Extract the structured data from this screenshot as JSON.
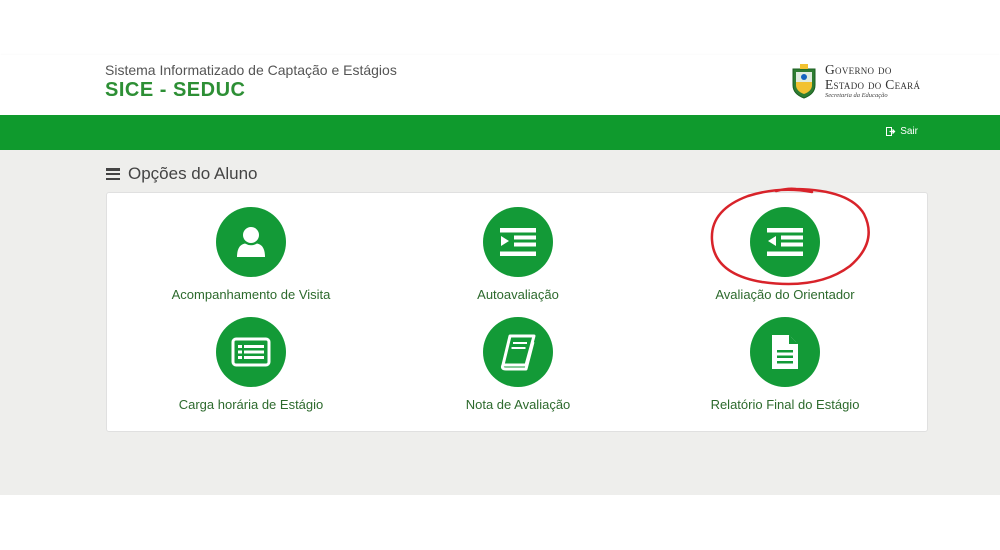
{
  "header": {
    "subtitle": "Sistema Informatizado de Captação e Estágios",
    "title": "SICE - SEDUC",
    "gov_logo": {
      "line1": "Governo do",
      "line2": "Estado do Ceará",
      "line3": "Secretaria da Educação"
    }
  },
  "navbar": {
    "logout_label": "Sair",
    "logout_icon": "sign-out-icon"
  },
  "section": {
    "title": "Opções do Aluno",
    "icon": "bars-icon"
  },
  "options": [
    {
      "label": "Acompanhamento de Visita",
      "icon": "user-icon"
    },
    {
      "label": "Autoavaliação",
      "icon": "indent-icon"
    },
    {
      "label": "Avaliação do Orientador",
      "icon": "outdent-icon",
      "highlighted": true
    },
    {
      "label": "Carga horária de Estágio",
      "icon": "list-alt-icon"
    },
    {
      "label": "Nota de Avaliação",
      "icon": "book-icon"
    },
    {
      "label": "Relatório Final do Estágio",
      "icon": "file-text-icon"
    }
  ],
  "colors": {
    "brand_green": "#2d8f35",
    "navbar_green": "#0f9a2d",
    "circle_green": "#139a37",
    "label_green": "#2d6a2d",
    "annotation_red": "#d8232a",
    "page_bg": "#eeeeec"
  }
}
